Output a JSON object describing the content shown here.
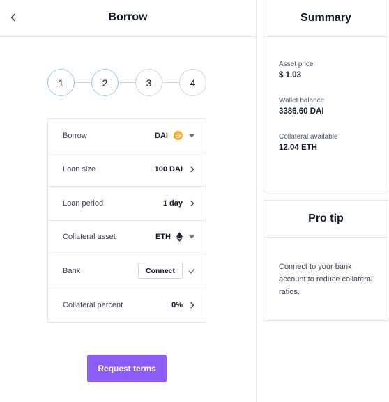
{
  "header": {
    "title": "Borrow",
    "back_icon": "chevron-left-icon"
  },
  "stepper": {
    "steps": [
      "1",
      "2",
      "3",
      "4"
    ],
    "active_steps": [
      1,
      2
    ]
  },
  "form": {
    "borrow": {
      "label": "Borrow",
      "value": "DAI",
      "token_icon": "dai-coin-icon",
      "control_icon": "caret-down-icon"
    },
    "loan_size": {
      "label": "Loan size",
      "value": "100 DAI",
      "control_icon": "chevron-right-icon"
    },
    "loan_period": {
      "label": "Loan period",
      "value": "1 day",
      "control_icon": "chevron-right-icon"
    },
    "collateral_asset": {
      "label": "Collateral asset",
      "value": "ETH",
      "token_icon": "eth-icon",
      "control_icon": "caret-down-icon"
    },
    "bank": {
      "label": "Bank",
      "button_label": "Connect",
      "status_icon": "check-icon"
    },
    "collateral_percent": {
      "label": "Collateral percent",
      "value": "0%",
      "control_icon": "chevron-right-icon"
    }
  },
  "actions": {
    "request_terms_label": "Request terms"
  },
  "summary": {
    "title": "Summary",
    "items": [
      {
        "label": "Asset price",
        "value": "$ 1.03"
      },
      {
        "label": "Wallet balance",
        "value": "3386.60 DAI"
      },
      {
        "label": "Collateral available",
        "value": "12.04 ETH"
      }
    ]
  },
  "protip": {
    "title": "Pro tip",
    "text": "Connect to your bank account to reduce collateral ratios."
  },
  "colors": {
    "accent": "#8b5cf6",
    "active_step_border": "#9ec5f0",
    "dai": "#f5ac37",
    "border": "#e5e7eb"
  }
}
